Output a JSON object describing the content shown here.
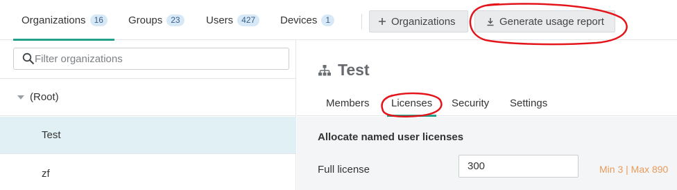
{
  "top_tabs": {
    "organizations": {
      "label": "Organizations",
      "count": "16"
    },
    "groups": {
      "label": "Groups",
      "count": "23"
    },
    "users": {
      "label": "Users",
      "count": "427"
    },
    "devices": {
      "label": "Devices",
      "count": "1"
    }
  },
  "toolbar": {
    "add_organizations_label": "Organizations",
    "generate_report_label": "Generate usage report"
  },
  "sidebar": {
    "search_placeholder": "Filter organizations",
    "tree": {
      "root_label": "(Root)",
      "items": [
        "Test",
        "zf"
      ]
    }
  },
  "detail": {
    "title": "Test",
    "tabs": {
      "members": "Members",
      "licenses": "Licenses",
      "security": "Security",
      "settings": "Settings"
    },
    "section_heading": "Allocate named user licenses",
    "full_license_label": "Full license",
    "full_license_value": "300",
    "range_text": "Min 3  |  Max 890"
  },
  "colors": {
    "accent": "#21a08a",
    "selected_row": "#e1f0f4",
    "count_badge": "#d7e8f7",
    "range_text": "#e79a5b",
    "annotation": "#e4141b"
  },
  "icons": {
    "add": "plus-icon",
    "download": "download-icon",
    "search": "search-icon",
    "organization": "org-hierarchy-icon",
    "expand": "caret-down-icon"
  }
}
